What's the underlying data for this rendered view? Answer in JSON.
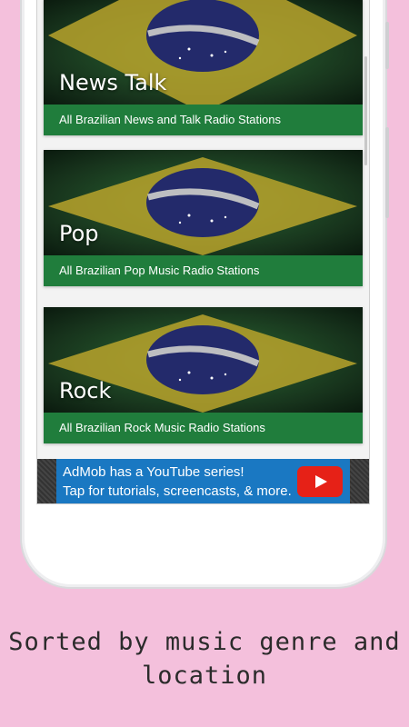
{
  "cards": [
    {
      "title": "News Talk",
      "description": "All Brazilian News and Talk Radio Stations"
    },
    {
      "title": "Pop",
      "description": "All Brazilian Pop Music Radio Stations"
    },
    {
      "title": "Rock",
      "description": "All Brazilian Rock Music Radio Stations"
    }
  ],
  "ad": {
    "line1": "AdMob has a YouTube series!",
    "line2": "Tap for tutorials, screencasts, & more."
  },
  "caption": {
    "line1": "Sorted by music genre and",
    "line2": "location"
  },
  "colors": {
    "background": "#f4c0dc",
    "card_bar": "#207d3c",
    "ad_blue": "#1a78c2",
    "youtube_red": "#e62117"
  },
  "icons": {
    "card_image": "brazil-flag-image",
    "ad_button": "youtube-play-icon"
  }
}
